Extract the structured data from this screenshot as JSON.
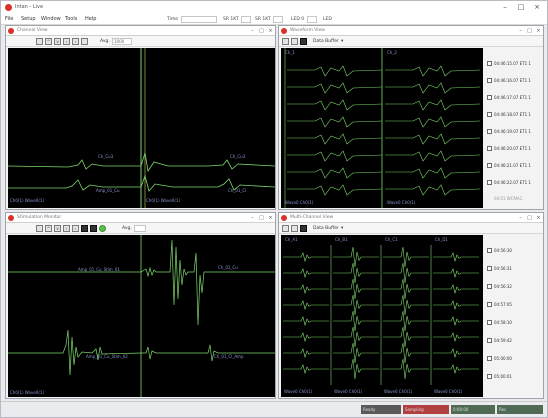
{
  "app": {
    "title": "Intan - Live"
  },
  "menu": {
    "items": [
      "File",
      "Setup",
      "Window",
      "Tools",
      "Help"
    ]
  },
  "menubar_fields": [
    {
      "label": "Time",
      "value": ""
    },
    {
      "label": "SR 1KT",
      "value": ""
    },
    {
      "label": "SR 1KT",
      "value": ""
    },
    {
      "label": "LED 0",
      "value": ""
    },
    {
      "label": "LED",
      "value": ""
    }
  ],
  "panel_tl": {
    "title": "Channel View",
    "toolbar_label": "Avg.",
    "toolbar_value": "1000",
    "traces": [
      "Ch_Cu3",
      "Ch_Cu3",
      "Amp_01_Cu",
      "Ch_01_Cl"
    ],
    "status": "Ch0(1) Wave0(1)",
    "status2": "Ch0(1) Wave0(1)"
  },
  "panel_tr": {
    "title": "Waveform View",
    "toolbar_label": "Data Buffer",
    "headers": [
      "Ch_1",
      "Ch_2"
    ],
    "status": "Wave0 Ch0(1)",
    "status2": "Wave0 Ch0(1)",
    "timestamps": [
      "04:46:15.07 ET1 1",
      "04:46:16.07 ET1 1",
      "04:46:17.07 ET1 1",
      "04:46:18.07 ET1 1",
      "04:46:19.07 ET1 1",
      "04:46:20.07 ET1 1",
      "04:46:21.07 ET1 1",
      "04:46:22.07 ET1 1"
    ],
    "footer": "04:51 WCMA1"
  },
  "panel_bl": {
    "title": "Stimulation Monitor",
    "toolbar_label": "Avg.",
    "toolbar_value": "Avg.",
    "traces": [
      "Amp_01_Cu_Stim_01",
      "Ch_01_Cu",
      "Amp_01_Cu_Stim_02",
      "Ch_01_Cl_Amp"
    ],
    "status": "Ch0(1) Wave0(1)"
  },
  "panel_br": {
    "title": "Multi-Channel View",
    "toolbar_label": "Data Buffer",
    "headers": [
      "Ch_A1",
      "Ch_B1",
      "Ch_C1",
      "Ch_D1"
    ],
    "status": [
      "Wave0 Ch0(1)",
      "Wave0 Ch0(1)",
      "Wave0 Ch0(1)",
      "Wave0 Ch0(1)"
    ],
    "timestamps": [
      "04:56:30",
      "04:56:31",
      "04:56:32",
      "04:57:05",
      "04:58:10",
      "04:59:42",
      "05:00:00",
      "05:00:01"
    ]
  },
  "statusbar": [
    "Ready",
    "Sampling",
    "0:00:00",
    "Rec"
  ],
  "colors": {
    "trace": "#7dd86b",
    "label": "#8a96cf",
    "scope_bg": "#000000",
    "accent": "#d9302a"
  }
}
